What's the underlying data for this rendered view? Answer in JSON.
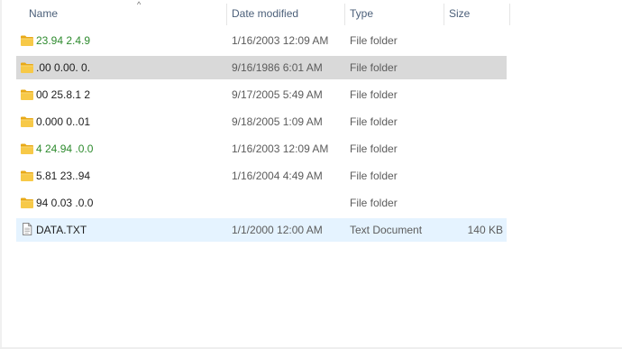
{
  "columns": {
    "name": "Name",
    "date": "Date modified",
    "type": "Type",
    "size": "Size"
  },
  "sort_indicator": "^",
  "rows": [
    {
      "name": "23.94 2.4.9",
      "date": "1/16/2003 12:09 AM",
      "type": "File folder",
      "size": "",
      "icon": "folder-icon",
      "state": "normal",
      "name_color": "#2e8b2e"
    },
    {
      "name": ".00 0.00. 0.",
      "date": "9/16/1986 6:01 AM",
      "type": "File folder",
      "size": "",
      "icon": "folder-icon",
      "state": "selected",
      "name_color": "#1f1f1f"
    },
    {
      "name": "00 25.8.1 2",
      "date": "9/17/2005 5:49 AM",
      "type": "File folder",
      "size": "",
      "icon": "folder-icon",
      "state": "normal",
      "name_color": "#1f1f1f"
    },
    {
      "name": "0.000 0..01",
      "date": "9/18/2005 1:09 AM",
      "type": "File folder",
      "size": "",
      "icon": "folder-icon",
      "state": "normal",
      "name_color": "#1f1f1f"
    },
    {
      "name": "4 24.94 .0.0",
      "date": "1/16/2003 12:09 AM",
      "type": "File folder",
      "size": "",
      "icon": "folder-icon",
      "state": "normal",
      "name_color": "#2e8b2e"
    },
    {
      "name": "5.81 23..94",
      "date": "1/16/2004 4:49 AM",
      "type": "File folder",
      "size": "",
      "icon": "folder-icon",
      "state": "normal",
      "name_color": "#1f1f1f"
    },
    {
      "name": "94 0.03 .0.0",
      "date": "",
      "type": "File folder",
      "size": "",
      "icon": "folder-icon",
      "state": "normal",
      "name_color": "#1f1f1f"
    },
    {
      "name": "DATA.TXT",
      "date": "1/1/2000 12:00 AM",
      "type": "Text Document",
      "size": "140 KB",
      "icon": "text-document-icon",
      "state": "hover",
      "name_color": "#1f1f1f"
    }
  ],
  "colors": {
    "selected_bg": "#d9d9d9",
    "hover_bg": "#e5f3ff",
    "compressed_name": "#2e8b2e",
    "header_text": "#4c607a"
  }
}
